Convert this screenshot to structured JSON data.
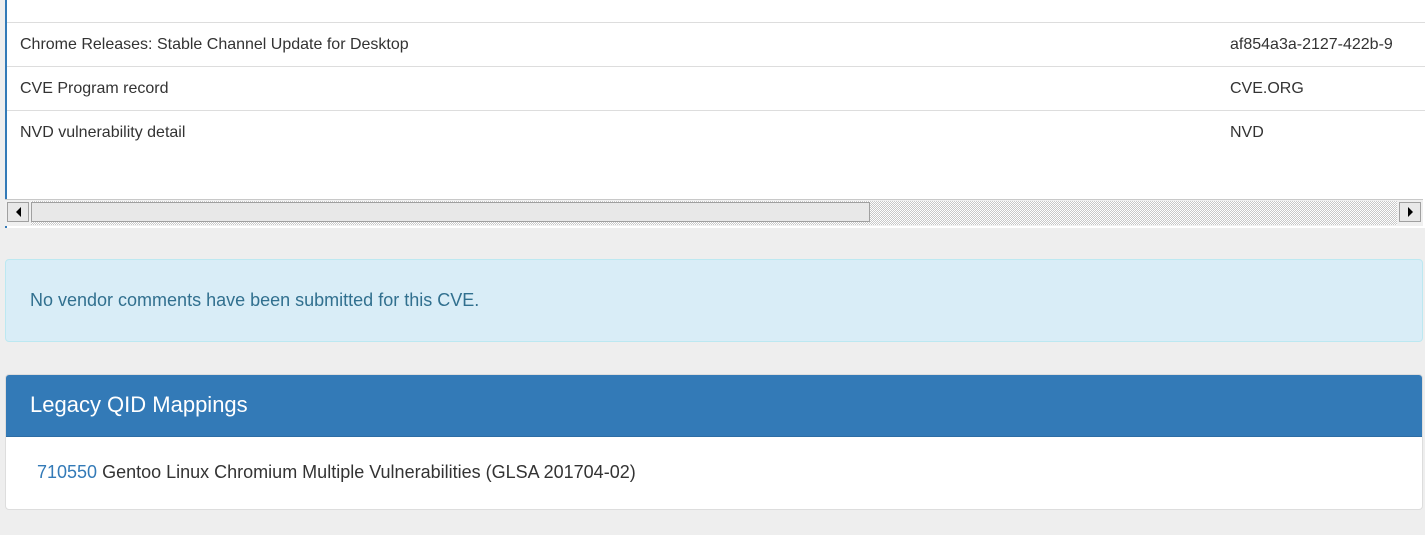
{
  "references": {
    "rows": [
      {
        "title": "Chrome Releases: Stable Channel Update for Desktop",
        "source": "af854a3a-2127-422b-9"
      },
      {
        "title": "CVE Program record",
        "source": "CVE.ORG"
      },
      {
        "title": "NVD vulnerability detail",
        "source": "NVD"
      }
    ]
  },
  "vendor_alert": {
    "text": "No vendor comments have been submitted for this CVE."
  },
  "legacy_qid": {
    "heading": "Legacy QID Mappings",
    "items": [
      {
        "qid": "710550",
        "description": "Gentoo Linux Chromium Multiple Vulnerabilities (GLSA 201704-02)"
      }
    ]
  },
  "colors": {
    "primary": "#337ab7",
    "info_bg": "#d9edf7",
    "info_text": "#31708f",
    "page_bg": "#eeeeee"
  }
}
